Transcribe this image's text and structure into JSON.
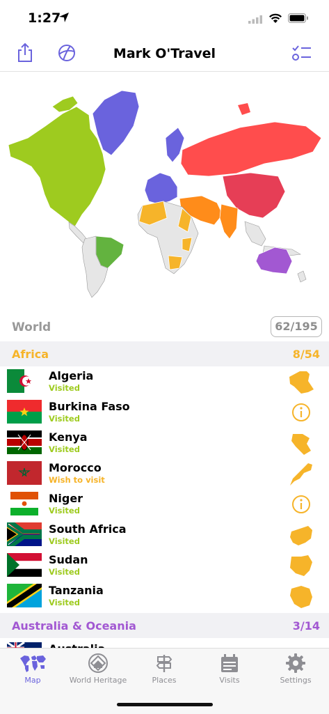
{
  "status_bar": {
    "time": "1:27"
  },
  "nav": {
    "title": "Mark O'Travel"
  },
  "world": {
    "label": "World",
    "count": "62/195"
  },
  "colors": {
    "accent": "#6a63dd",
    "visited": "#9ecb1f",
    "wish": "#f6b42a",
    "africa": "#f6b42a",
    "oceania": "#a258d2"
  },
  "sections": [
    {
      "name": "Africa",
      "count": "8/54",
      "countries": [
        {
          "name": "Algeria",
          "status": "Visited"
        },
        {
          "name": "Burkina Faso",
          "status": "Visited"
        },
        {
          "name": "Kenya",
          "status": "Visited"
        },
        {
          "name": "Morocco",
          "status": "Wish to visit"
        },
        {
          "name": "Niger",
          "status": "Visited"
        },
        {
          "name": "South Africa",
          "status": "Visited"
        },
        {
          "name": "Sudan",
          "status": "Visited"
        },
        {
          "name": "Tanzania",
          "status": "Visited"
        }
      ]
    },
    {
      "name": "Australia & Oceania",
      "count": "3/14",
      "countries": [
        {
          "name": "Australia",
          "status": ""
        }
      ]
    }
  ],
  "tabs": [
    {
      "label": "Map",
      "icon": "world-map-icon",
      "active": true
    },
    {
      "label": "World Heritage",
      "icon": "heritage-icon"
    },
    {
      "label": "Places",
      "icon": "signpost-icon"
    },
    {
      "label": "Visits",
      "icon": "calendar-icon"
    },
    {
      "label": "Settings",
      "icon": "gear-icon"
    }
  ]
}
